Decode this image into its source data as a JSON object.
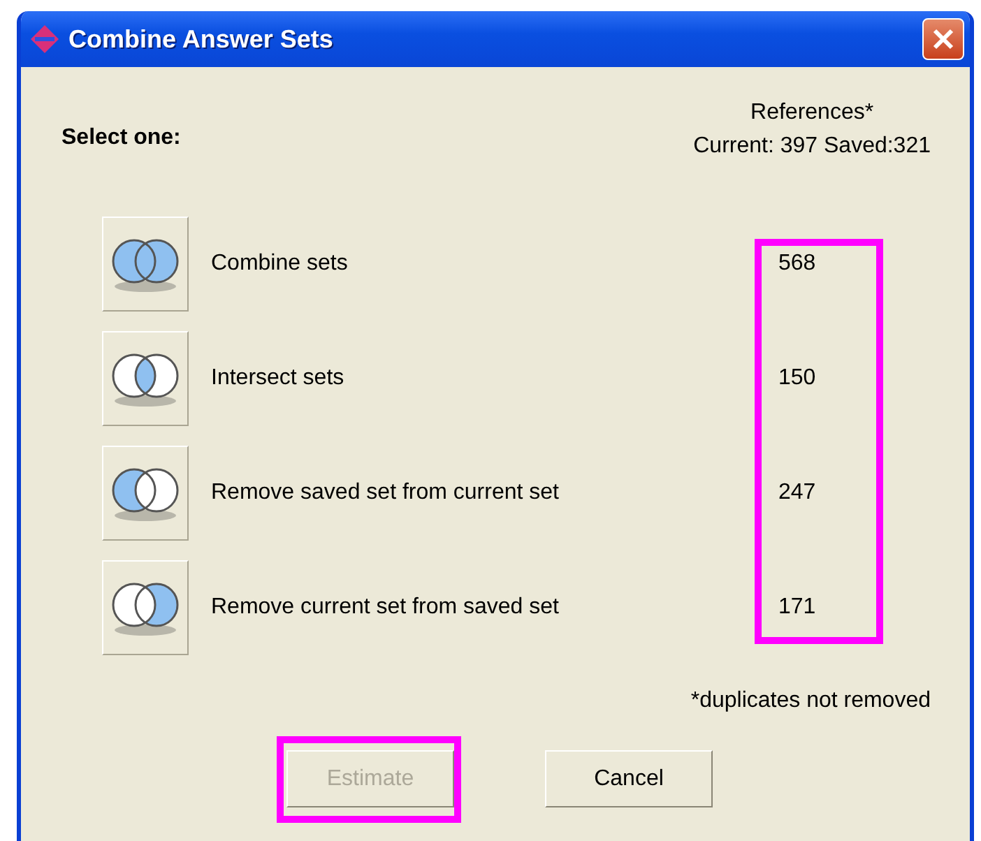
{
  "window": {
    "title": "Combine Answer Sets"
  },
  "prompt": "Select one:",
  "references": {
    "heading": "References*",
    "totals": "Current: 397 Saved:321"
  },
  "options": [
    {
      "kind": "union",
      "label": "Combine sets",
      "count": "568"
    },
    {
      "kind": "intersect",
      "label": "Intersect sets",
      "count": "150"
    },
    {
      "kind": "left",
      "label": "Remove saved set from current set",
      "count": "247"
    },
    {
      "kind": "right",
      "label": "Remove current set from saved set",
      "count": "171"
    }
  ],
  "footnote": "*duplicates not removed",
  "buttons": [
    {
      "label": "Estimate",
      "disabled": true
    },
    {
      "label": "Cancel",
      "disabled": false
    }
  ]
}
